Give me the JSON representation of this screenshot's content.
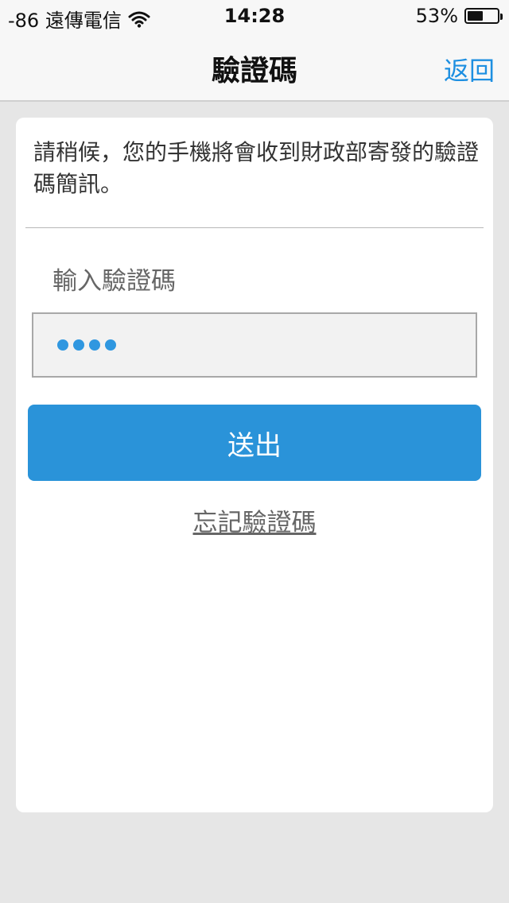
{
  "status_bar": {
    "carrier": "-86 遠傳電信",
    "time": "14:28",
    "battery": "53%",
    "battery_level": 0.53
  },
  "navbar": {
    "title": "驗證碼",
    "back_label": "返回"
  },
  "form": {
    "message": "請稍候，您的手機將會收到財政部寄發的驗證碼簡訊。",
    "input_label": "輸入驗證碼",
    "masked_value": "••••",
    "submit_label": "送出",
    "forgot_label": "忘記驗證碼"
  },
  "colors": {
    "accent": "#1d8fe1",
    "button": "#2a93d9",
    "background": "#e6e6e6"
  },
  "icons": {
    "wifi": "wifi-icon",
    "battery": "battery-icon"
  }
}
